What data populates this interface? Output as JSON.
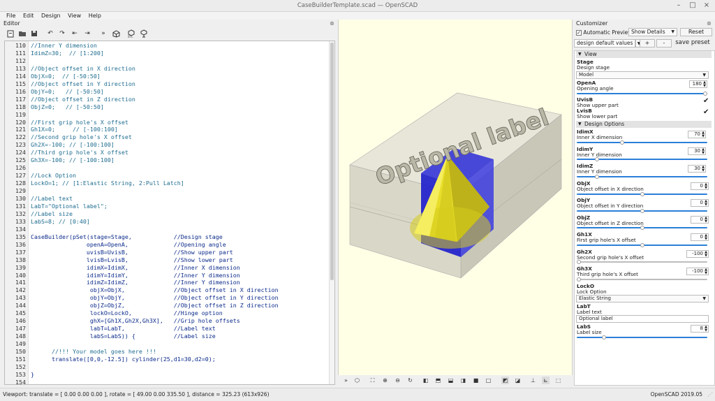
{
  "window": {
    "title": "CaseBuilderTemplate.scad — OpenSCAD"
  },
  "menu": [
    "File",
    "Edit",
    "Design",
    "View",
    "Help"
  ],
  "editor": {
    "title": "Editor",
    "lines": [
      {
        "n": "110",
        "t": "//Inner Y dimension",
        "k": "com"
      },
      {
        "n": "111",
        "t": "IdimZ=30;  // [1:200]",
        "k": "com"
      },
      {
        "n": "112",
        "t": "",
        "k": ""
      },
      {
        "n": "113",
        "t": "//Object offset in X direction",
        "k": "com"
      },
      {
        "n": "114",
        "t": "ObjX=0;  // [-50:50]",
        "k": "com"
      },
      {
        "n": "115",
        "t": "//Object offset in Y direction",
        "k": "com"
      },
      {
        "n": "116",
        "t": "ObjY=0;   // [-50:50]",
        "k": "com"
      },
      {
        "n": "117",
        "t": "//Object offset in Z direction",
        "k": "com"
      },
      {
        "n": "118",
        "t": "ObjZ=0;   // [-50:50]",
        "k": "com"
      },
      {
        "n": "119",
        "t": "",
        "k": ""
      },
      {
        "n": "120",
        "t": "//First grip hole's X offset",
        "k": "com"
      },
      {
        "n": "121",
        "t": "Gh1X=0;     // [-100:100]",
        "k": "com"
      },
      {
        "n": "122",
        "t": "//Second grip hole's X offset",
        "k": "com"
      },
      {
        "n": "123",
        "t": "Gh2X=-100; // [-100:100]",
        "k": "com"
      },
      {
        "n": "124",
        "t": "//Third grip hole's X offset",
        "k": "com"
      },
      {
        "n": "125",
        "t": "Gh3X=-100; // [-100:100]",
        "k": "com"
      },
      {
        "n": "126",
        "t": "",
        "k": ""
      },
      {
        "n": "127",
        "t": "//Lock Option",
        "k": "com"
      },
      {
        "n": "128",
        "t": "LockO=1; // [1:Elastic String, 2:Pull Latch]",
        "k": "com"
      },
      {
        "n": "129",
        "t": "",
        "k": ""
      },
      {
        "n": "130",
        "t": "//Label text",
        "k": "com"
      },
      {
        "n": "131",
        "t": "LabT=\"Optional label\";",
        "k": "com"
      },
      {
        "n": "132",
        "t": "//Label size",
        "k": "com"
      },
      {
        "n": "133",
        "t": "LabS=8; // [0:40]",
        "k": "com"
      },
      {
        "n": "134",
        "t": "",
        "k": ""
      },
      {
        "n": "135",
        "t": "CaseBuilder(pSet(stage=Stage,            //Design stage",
        "k": "kw"
      },
      {
        "n": "136",
        "t": "                openA=OpenA,             //Opening angle",
        "k": "kw"
      },
      {
        "n": "137",
        "t": "                uvisB=UvisB,             //Show upper part",
        "k": "kw"
      },
      {
        "n": "138",
        "t": "                lvisB=LvisB,             //Show lower part",
        "k": "kw"
      },
      {
        "n": "139",
        "t": "                idimX=IdimX,             //Inner X dimension",
        "k": "kw"
      },
      {
        "n": "140",
        "t": "                idimY=IdimY,             //Inner Y dimension",
        "k": "kw"
      },
      {
        "n": "141",
        "t": "                idimZ=IdimZ,             //Inner Y dimension",
        "k": "kw"
      },
      {
        "n": "142",
        "t": "                 objX=ObjX,              //Object offset in X direction",
        "k": "kw"
      },
      {
        "n": "143",
        "t": "                 objY=ObjY,              //Object offset in Y direction",
        "k": "kw"
      },
      {
        "n": "144",
        "t": "                 objZ=ObjZ,              //Object offset in Z direction",
        "k": "kw"
      },
      {
        "n": "145",
        "t": "                 lockO=LockO,            //Hinge option",
        "k": "kw"
      },
      {
        "n": "146",
        "t": "                 ghX=[Gh1X,Gh2X,Gh3X],   //Grip hole offsets",
        "k": "kw"
      },
      {
        "n": "147",
        "t": "                 labT=LabT,              //Label text",
        "k": "kw"
      },
      {
        "n": "148",
        "t": "                 labS=LabS)) {           //Label size",
        "k": "kw"
      },
      {
        "n": "149",
        "t": "",
        "k": ""
      },
      {
        "n": "150",
        "t": "      //!!! Your model goes here !!!",
        "k": "com"
      },
      {
        "n": "151",
        "t": "      translate([0,0,-12.5]) cylinder(25,d1=30,d2=0);",
        "k": "kw"
      },
      {
        "n": "152",
        "t": "",
        "k": ""
      },
      {
        "n": "153",
        "t": "}",
        "k": "kw"
      },
      {
        "n": "154",
        "t": "",
        "k": ""
      }
    ]
  },
  "model": {
    "label_text": "Optional label"
  },
  "status": {
    "viewport": "Viewport: translate = [ 0.00 0.00 0.00 ], rotate = [ 49.00 0.00 335.50 ], distance = 325.23 (613x926)",
    "version": "OpenSCAD 2019.05"
  },
  "customizer": {
    "title": "Customizer",
    "auto_preview": "Automatic Preview",
    "show_details": "Show Details",
    "reset": "Reset",
    "preset": "design default values",
    "plus": "+",
    "minus": "-",
    "save_preset": "save preset",
    "sections": {
      "view": "View",
      "design": "Design Options"
    },
    "params": {
      "stage": {
        "name": "Stage",
        "desc": "Design stage",
        "value": "Model"
      },
      "opena": {
        "name": "OpenA",
        "desc": "Opening angle",
        "value": "180",
        "fraction": 1.0
      },
      "uvisb": {
        "name": "UvisB",
        "desc": "Show upper part",
        "checked": "✔"
      },
      "lvisb": {
        "name": "LvisB",
        "desc": "Show lower part",
        "checked": "✔"
      },
      "idimx": {
        "name": "IdimX",
        "desc": "Inner X dimension",
        "value": "70",
        "fraction": 0.345
      },
      "idimy": {
        "name": "IdimY",
        "desc": "Inner Y dimension",
        "value": "30",
        "fraction": 0.145
      },
      "idimz": {
        "name": "IdimZ",
        "desc": "Inner Y dimension",
        "value": "30",
        "fraction": 0.145
      },
      "objx": {
        "name": "ObjX",
        "desc": "Object offset in X direction",
        "value": "0",
        "fraction": 0.5
      },
      "objy": {
        "name": "ObjY",
        "desc": "Object offset in Y direction",
        "value": "0",
        "fraction": 0.5
      },
      "objz": {
        "name": "ObjZ",
        "desc": "Object offset in Z direction",
        "value": "0",
        "fraction": 0.5
      },
      "gh1x": {
        "name": "Gh1X",
        "desc": "First grip hole's X offset",
        "value": "0",
        "fraction": 0.5
      },
      "gh2x": {
        "name": "Gh2X",
        "desc": "Second grip hole's X offset",
        "value": "-100",
        "fraction": 0.0
      },
      "gh3x": {
        "name": "Gh3X",
        "desc": "Third grip hole's X offset",
        "value": "-100",
        "fraction": 0.0
      },
      "locko": {
        "name": "LockO",
        "desc": "Lock Option",
        "value": "Elastic String"
      },
      "labt": {
        "name": "LabT",
        "desc": "Label text",
        "value": "Optional label"
      },
      "labs": {
        "name": "LabS",
        "desc": "Label size",
        "value": "8",
        "fraction": 0.2
      }
    }
  }
}
